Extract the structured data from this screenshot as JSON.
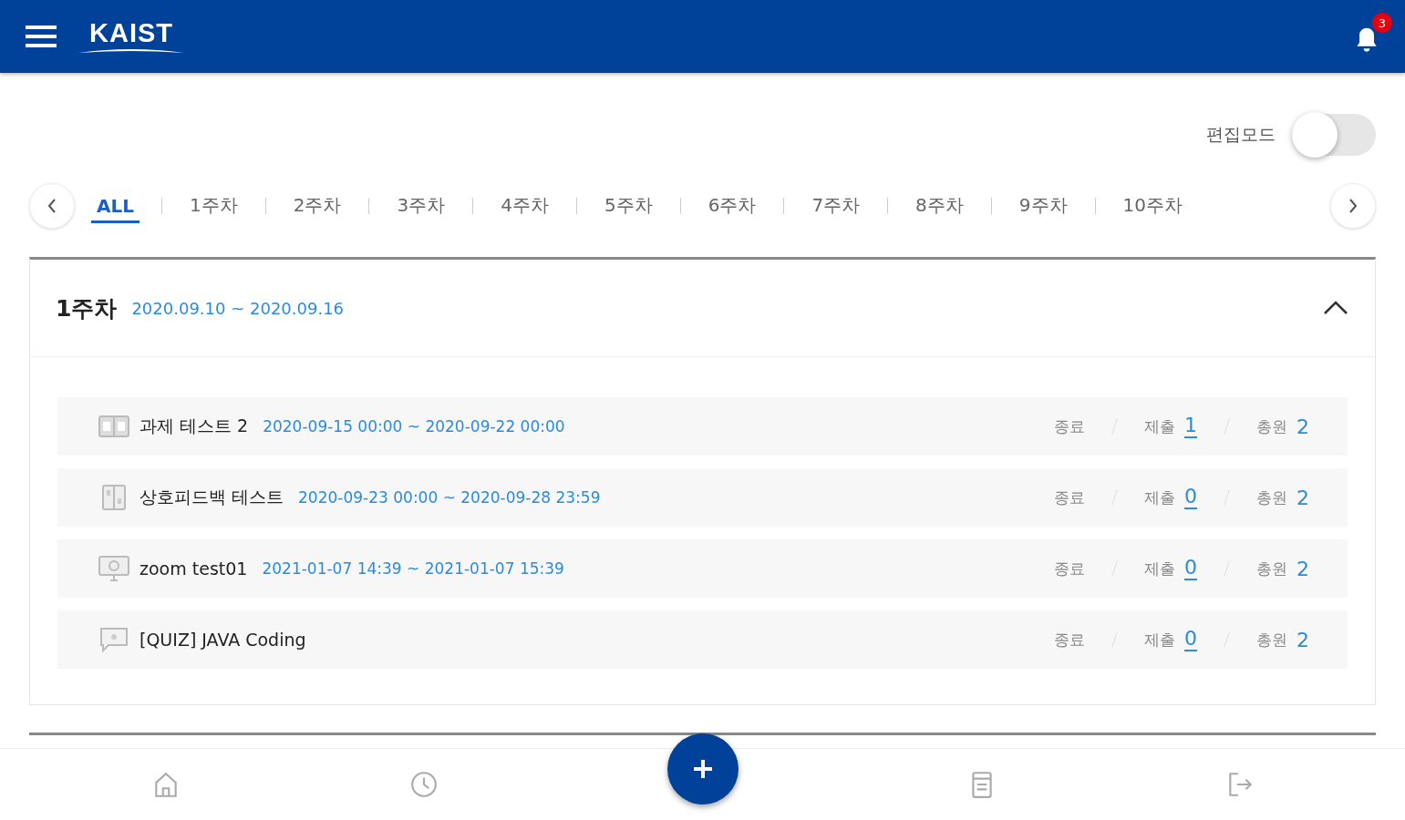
{
  "header": {
    "logo": "KAIST",
    "notification_count": "3"
  },
  "edit_mode": {
    "label": "편집모드",
    "on": false
  },
  "tabs": [
    {
      "label": "ALL",
      "selected": true
    },
    {
      "label": "1주차",
      "selected": false
    },
    {
      "label": "2주차",
      "selected": false
    },
    {
      "label": "3주차",
      "selected": false
    },
    {
      "label": "4주차",
      "selected": false
    },
    {
      "label": "5주차",
      "selected": false
    },
    {
      "label": "6주차",
      "selected": false
    },
    {
      "label": "7주차",
      "selected": false
    },
    {
      "label": "8주차",
      "selected": false
    },
    {
      "label": "9주차",
      "selected": false
    },
    {
      "label": "10주차",
      "selected": false
    }
  ],
  "week": {
    "title": "1주차",
    "period": "2020.09.10 ~ 2020.09.16",
    "expanded": true,
    "items": [
      {
        "kind": "assignment",
        "title": "과제 테스트 2",
        "period": "2020-09-15 00:00 ~ 2020-09-22 00:00",
        "status": "종료",
        "submitted_label": "제출",
        "submitted": "1",
        "total_label": "총원",
        "total": "2"
      },
      {
        "kind": "feedback",
        "title": "상호피드백 테스트",
        "period": "2020-09-23 00:00 ~ 2020-09-28 23:59",
        "status": "종료",
        "submitted_label": "제출",
        "submitted": "0",
        "total_label": "총원",
        "total": "2"
      },
      {
        "kind": "video",
        "title": "zoom test01",
        "period": "2021-01-07 14:39 ~ 2021-01-07 15:39",
        "status": "종료",
        "submitted_label": "제출",
        "submitted": "0",
        "total_label": "총원",
        "total": "2"
      },
      {
        "kind": "quiz",
        "title": "[QUIZ] JAVA Coding",
        "status": "종료",
        "submitted_label": "제출",
        "submitted": "0",
        "total_label": "총원",
        "total": "2"
      }
    ]
  }
}
